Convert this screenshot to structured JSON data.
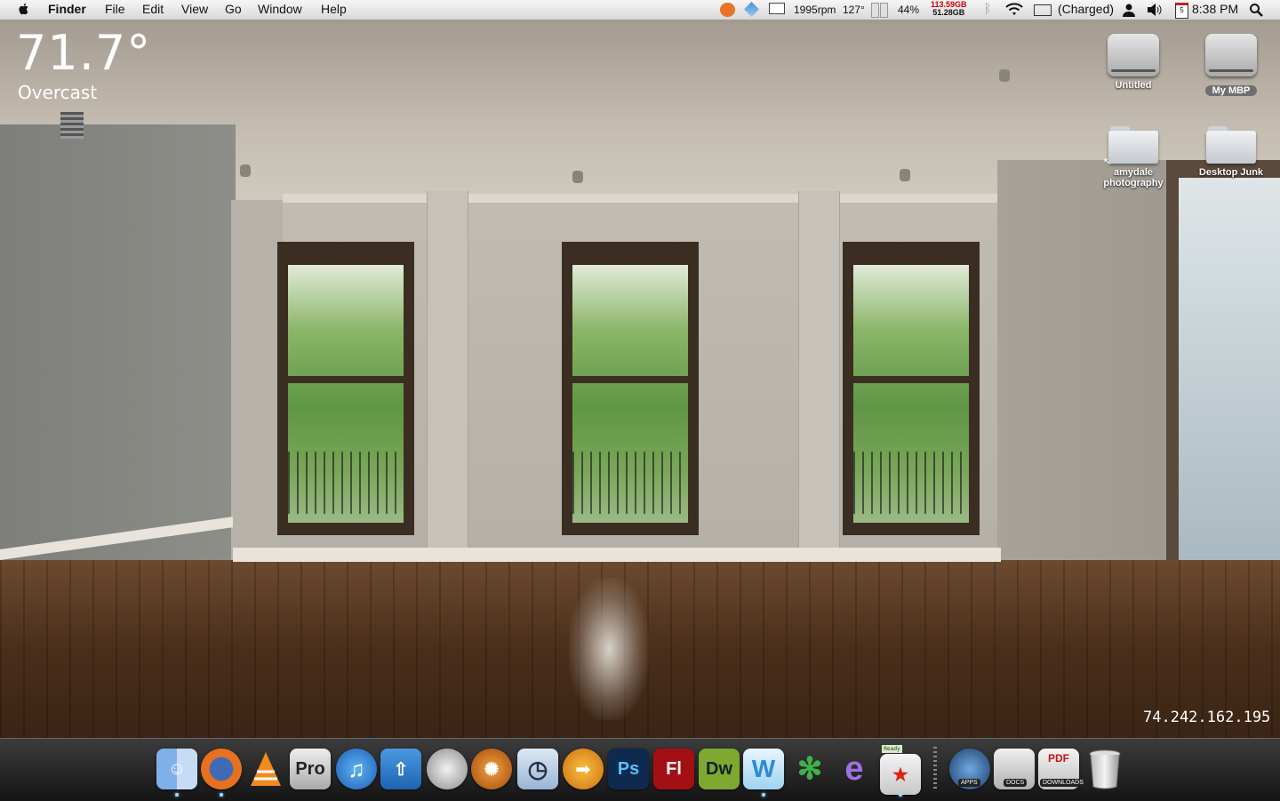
{
  "menubar": {
    "app_name": "Finder",
    "menus": [
      "File",
      "Edit",
      "View",
      "Go",
      "Window",
      "Help"
    ],
    "status": {
      "fan_speed": "1995rpm",
      "temperature": "127°",
      "cpu_percent": "44%",
      "disk_used": "113.59GB",
      "disk_free": "51.28GB",
      "battery": "(Charged)",
      "calendar_day": "5",
      "clock": "8:38 PM"
    }
  },
  "weather": {
    "temperature": "71.7°",
    "condition": "Overcast"
  },
  "desktop_icons": [
    {
      "label": "Untitled",
      "kind": "drive"
    },
    {
      "label": "My MBP",
      "kind": "drive",
      "selected": true
    },
    {
      "label": "amydale photography",
      "kind": "folder-alias"
    },
    {
      "label": "Desktop Junk",
      "kind": "folder"
    }
  ],
  "ip_address": "74.242.162.195",
  "dock": {
    "apps": [
      {
        "name": "Finder",
        "icon": "finder-icon",
        "running": true,
        "glyph": ""
      },
      {
        "name": "Firefox",
        "icon": "firefox-icon",
        "running": true,
        "glyph": ""
      },
      {
        "name": "VLC",
        "icon": "vlc-icon",
        "running": false,
        "glyph": ""
      },
      {
        "name": "Pro",
        "icon": "pro-icon",
        "running": false,
        "glyph": "Pro"
      },
      {
        "name": "iTunes",
        "icon": "itunes-icon",
        "running": false,
        "glyph": "♫"
      },
      {
        "name": "Transmit",
        "icon": "upload-icon",
        "running": false,
        "glyph": "⇧"
      },
      {
        "name": "Shield",
        "icon": "shield-icon",
        "running": false,
        "glyph": ""
      },
      {
        "name": "Reason",
        "icon": "reason-icon",
        "running": false,
        "glyph": "✺"
      },
      {
        "name": "Alarm Clock",
        "icon": "clock-icon",
        "running": false,
        "glyph": "◷"
      },
      {
        "name": "Runner",
        "icon": "runner-icon",
        "running": false,
        "glyph": "➟"
      },
      {
        "name": "Photoshop",
        "icon": "photoshop-icon",
        "running": false,
        "glyph": "Ps"
      },
      {
        "name": "Flash",
        "icon": "flash-icon",
        "running": false,
        "glyph": "Fl"
      },
      {
        "name": "Dreamweaver",
        "icon": "dreamweaver-icon",
        "running": false,
        "glyph": "Dw"
      },
      {
        "name": "Wii",
        "icon": "wii-icon",
        "running": true,
        "glyph": "W"
      },
      {
        "name": "Growl",
        "icon": "growl-icon",
        "running": false,
        "glyph": "✻"
      },
      {
        "name": "Adium",
        "icon": "adium-icon",
        "running": false,
        "glyph": "e"
      },
      {
        "name": "Transmission",
        "icon": "transmission-icon",
        "running": true,
        "glyph": "★"
      }
    ],
    "ready_tag": "Ready",
    "stacks": [
      "APPS",
      "DOCS",
      "DOWNLOADS"
    ],
    "trash": "Trash"
  }
}
